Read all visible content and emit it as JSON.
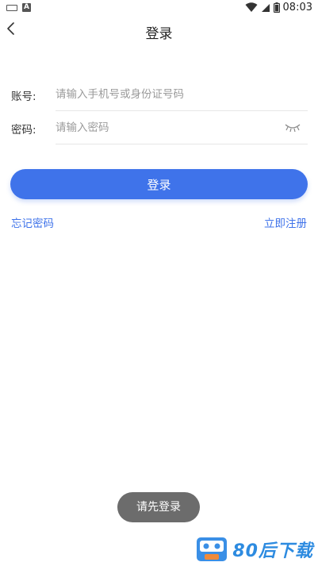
{
  "status_bar": {
    "time": "08:03",
    "left_icons": [
      "keyboard-icon",
      "a-notification-icon"
    ],
    "right_icons": [
      "wifi-icon",
      "signal-icon",
      "battery-icon"
    ],
    "left_badge_letter": "A"
  },
  "nav": {
    "back_icon": "chevron-left-icon",
    "title": "登录"
  },
  "form": {
    "account": {
      "label": "账号:",
      "placeholder": "请输入手机号或身份证号码",
      "value": ""
    },
    "password": {
      "label": "密码:",
      "placeholder": "请输入密码",
      "value": "",
      "toggle_icon": "eye-closed-icon"
    }
  },
  "actions": {
    "login_label": "登录",
    "forgot_label": "忘记密码",
    "register_label": "立即注册"
  },
  "toast": {
    "text": "请先登录"
  },
  "watermark": {
    "text": "80后下载",
    "icon": "cassette-logo-icon"
  },
  "colors": {
    "accent": "#3f73ea",
    "toast_bg": "#6c6c6c",
    "watermark": "#2d8be0"
  }
}
